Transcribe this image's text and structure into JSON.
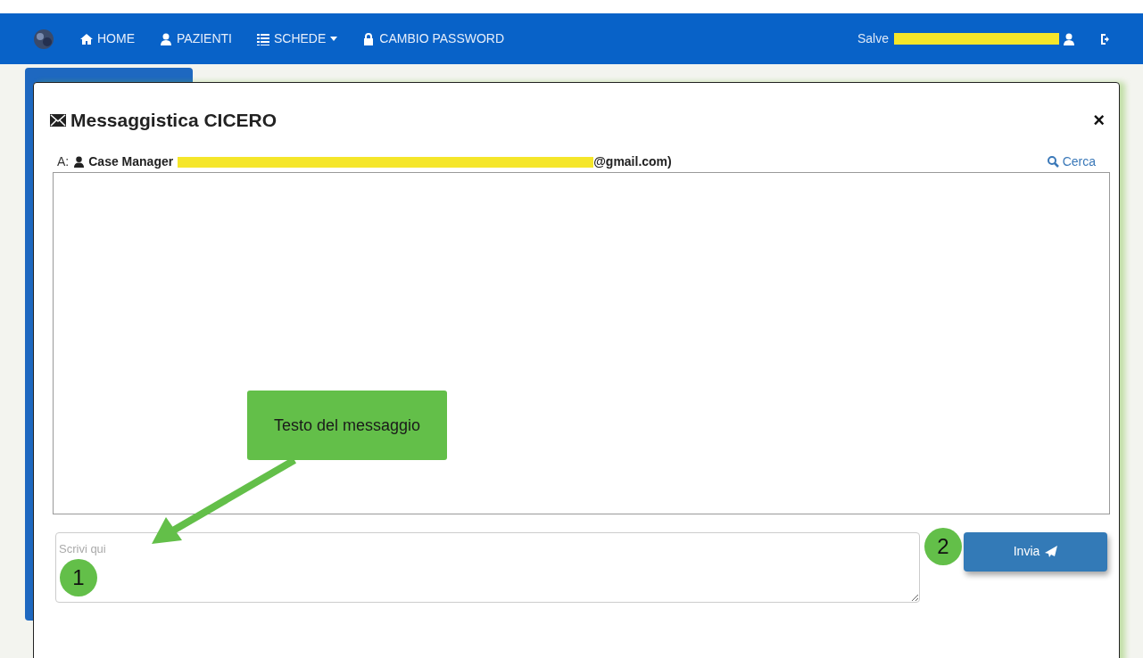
{
  "navbar": {
    "items": [
      {
        "label": "HOME",
        "dropdown": false
      },
      {
        "label": "PAZIENTI",
        "dropdown": false
      },
      {
        "label": "SCHEDE",
        "dropdown": true
      },
      {
        "label": "CAMBIO PASSWORD",
        "dropdown": false
      }
    ],
    "greeting": "Salve"
  },
  "modal": {
    "title": "Messaggistica CICERO",
    "close": "×",
    "recipient": {
      "prefix": "A:",
      "name": "Case Manager",
      "email_tail": "@gmail.com)"
    },
    "search_link": "Cerca",
    "composer": {
      "placeholder": "Scrivi qui"
    },
    "send_button": "Invia"
  },
  "annotations": {
    "callout": "Testo del messaggio",
    "steps": [
      {
        "number": "1"
      },
      {
        "number": "2"
      }
    ]
  }
}
